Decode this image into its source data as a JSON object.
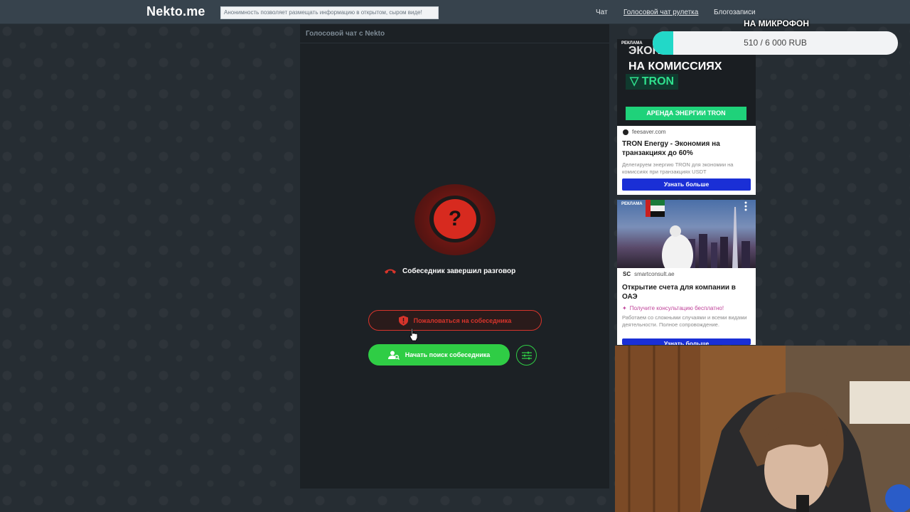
{
  "header": {
    "logo": "Nekto.me",
    "notice": "Анонимность позволяет размещать информацию в открытом, сыром виде!",
    "nav": [
      {
        "label": "Чат",
        "active": false
      },
      {
        "label": "Голосовой чат рулетка",
        "active": true
      },
      {
        "label": "Блогозаписи",
        "active": false
      }
    ]
  },
  "panel": {
    "title": "Голосовой чат с Nekto",
    "avatar_symbol": "?",
    "status_text": "Собеседник завершил разговор",
    "report_label": "Пожаловаться на собеседника",
    "search_label": "Начать поиск собеседника"
  },
  "ads": {
    "ad1": {
      "tag": "РЕКЛАМА",
      "line1": "ЭКОНОМЬ",
      "line2": "НА КОМИССИЯХ",
      "badge": "TRON",
      "cta": "АРЕНДА ЭНЕРГИИ TRON",
      "domain": "feesaver.com",
      "headline": "TRON Energy - Экономия на транзакциях до 60%",
      "description": "Делегируем энергию TRON для экономии на комиссиях при транзакциях USDT",
      "button": "Узнать больше"
    },
    "ad2": {
      "tag": "РЕКЛАМА",
      "domain": "smartconsult.ae",
      "headline": "Открытие счета для компании в ОАЭ",
      "consult": "Получите консультацию бесплатно!",
      "description": "Работаем со сложными случаями и всеми видами деятельности. Полное сопровождение.",
      "button": "Узнать больше"
    }
  },
  "overlay": {
    "donation_title": "НА МИКРОФОН",
    "donation_progress": "510 / 6 000 RUB",
    "donation_fraction": 0.085
  },
  "colors": {
    "header_bg": "#37434d",
    "accent_green": "#2fcd45",
    "accent_red": "#d6342b",
    "ad_button_blue": "#1a2fd6"
  }
}
